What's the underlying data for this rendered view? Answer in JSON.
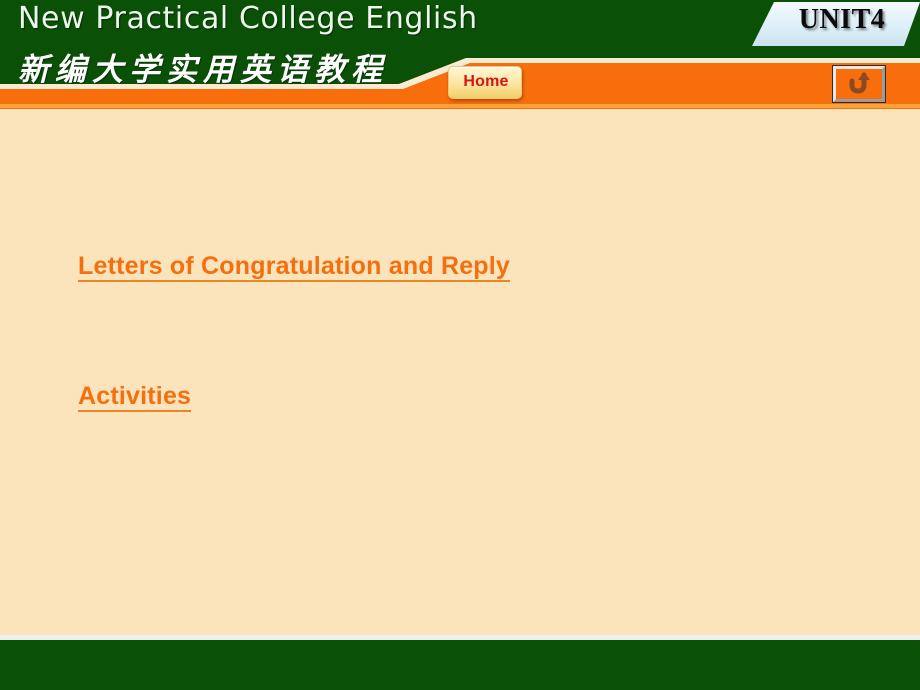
{
  "header": {
    "title_en": "New Practical College English",
    "title_cn": "新编大学实用英语教程",
    "unit_badge": "UNIT4",
    "home_button": "Home",
    "back_button_icon": "return-arrow-icon",
    "colors": {
      "masthead_green": "#0A5006",
      "bar_orange": "#F96E0C",
      "badge_fill": "#DCEEF7",
      "home_text_red": "#D71414"
    }
  },
  "main": {
    "links": [
      {
        "label": "Letters of Congratulation and Reply"
      },
      {
        "label": "Activities"
      }
    ],
    "colors": {
      "background_cream": "#FBE3BC",
      "link_orange": "#F4700F",
      "underline_orange": "#E98723"
    }
  },
  "footer": {
    "colors": {
      "band_green": "#0A5006",
      "rule": "#EFEFEF"
    }
  }
}
